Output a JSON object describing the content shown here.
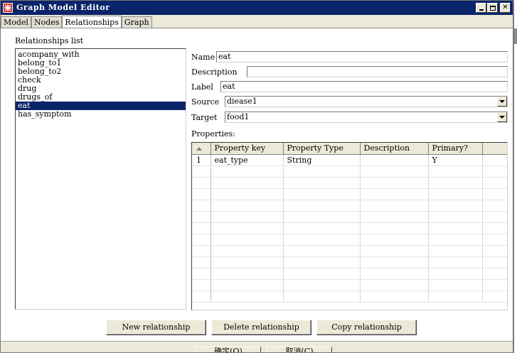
{
  "window": {
    "title": "Graph Model Editor"
  },
  "tabs": [
    {
      "label": "Model"
    },
    {
      "label": "Nodes"
    },
    {
      "label": "Relationships"
    },
    {
      "label": "Graph"
    }
  ],
  "active_tab": "Relationships",
  "relationships": {
    "label": "Relationships list",
    "items": [
      "acompany_with",
      "belong_to1",
      "belong_to2",
      "check",
      "drug",
      "drugs_of",
      "eat",
      "has_symptom"
    ],
    "selected": "eat"
  },
  "form": {
    "name_label": "Name",
    "name_value": "eat",
    "description_label": "Description",
    "description_value": "",
    "label_label": "Label",
    "label_value": "eat",
    "source_label": "Source",
    "source_value": "diease1",
    "target_label": "Target",
    "target_value": "food1",
    "properties_label": "Properties:"
  },
  "properties_table": {
    "columns": [
      "",
      "Property key",
      "Property Type",
      "Description",
      "Primary?"
    ],
    "rows": [
      {
        "num": "1",
        "key": "eat_type",
        "type": "String",
        "description": "",
        "primary": "Y"
      }
    ]
  },
  "buttons": {
    "new": "New relationship",
    "delete": "Delete relationship",
    "copy": "Copy relationship"
  },
  "dialog_buttons": {
    "ok": "确定(O)",
    "cancel": "取消(C)"
  },
  "colors": {
    "titlebar": "#0a246a",
    "selection": "#0a246a",
    "face": "#ece9d8"
  }
}
